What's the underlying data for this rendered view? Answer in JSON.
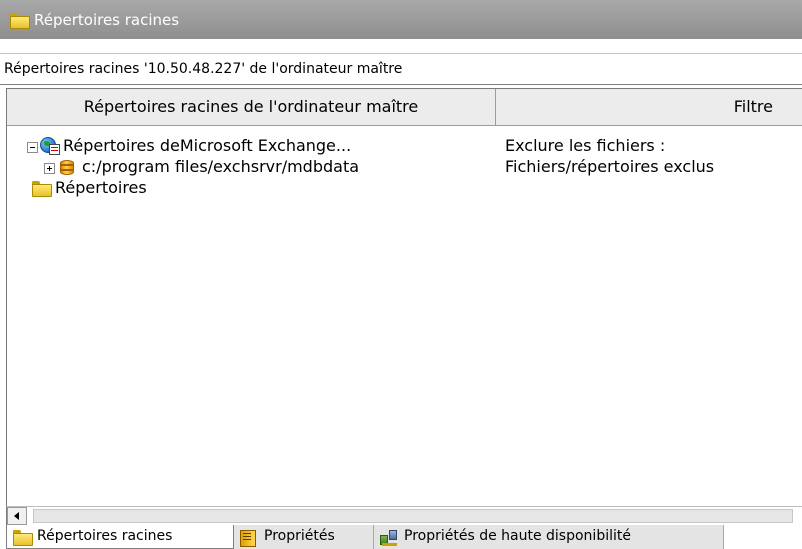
{
  "window": {
    "title": "Répertoires racines"
  },
  "infobar": {
    "text": "Répertoires racines '10.50.48.227' de l'ordinateur maître"
  },
  "table": {
    "columns": [
      "Répertoires racines de l'ordinateur maître",
      "Filtre"
    ],
    "rows": [
      {
        "label": "Répertoires deMicrosoft Exchange...",
        "filter": "Exclure les fichiers :",
        "icon": "exchange-globe-icon",
        "expander": "minus"
      },
      {
        "label": "c:/program files/exchsrvr/mdbdata",
        "filter": "Fichiers/répertoires exclus",
        "icon": "database-icon",
        "expander": "plus"
      },
      {
        "label": "Répertoires",
        "filter": "",
        "icon": "folder-icon",
        "expander": ""
      }
    ]
  },
  "tabs": [
    {
      "label": "Répertoires racines",
      "icon": "folder-icon",
      "active": true
    },
    {
      "label": "Propriétés",
      "icon": "properties-book-icon",
      "active": false
    },
    {
      "label": "Propriétés de haute disponibilité",
      "icon": "cluster-icon",
      "active": false
    }
  ]
}
